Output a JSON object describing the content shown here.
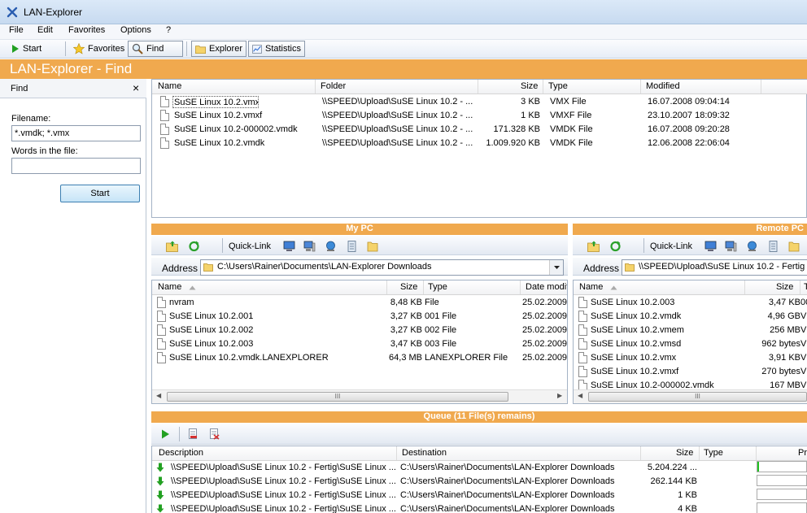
{
  "window": {
    "title": "LAN-Explorer"
  },
  "menu": {
    "file": "File",
    "edit": "Edit",
    "favorites": "Favorites",
    "options": "Options",
    "help": "?"
  },
  "toolbar": {
    "start": "Start",
    "favorites": "Favorites",
    "find": "Find",
    "explorer": "Explorer",
    "statistics": "Statistics"
  },
  "banner": {
    "title": "LAN-Explorer - Find"
  },
  "find_panel": {
    "header": "Find",
    "close": "×",
    "filename_label": "Filename:",
    "filename_value": "*.vmdk; *.vmx",
    "words_label": "Words in the file:",
    "words_value": "",
    "start_button": "Start"
  },
  "results": {
    "columns": {
      "name": "Name",
      "folder": "Folder",
      "size": "Size",
      "type": "Type",
      "modified": "Modified"
    },
    "rows": [
      {
        "name": "SuSE Linux 10.2.vmx",
        "folder": "\\\\SPEED\\Upload\\SuSE Linux 10.2 - ...",
        "size": "3 KB",
        "type": "VMX File",
        "modified": "16.07.2008 09:04:14"
      },
      {
        "name": "SuSE Linux 10.2.vmxf",
        "folder": "\\\\SPEED\\Upload\\SuSE Linux 10.2 - ...",
        "size": "1 KB",
        "type": "VMXF File",
        "modified": "23.10.2007 18:09:32"
      },
      {
        "name": "SuSE Linux 10.2-000002.vmdk",
        "folder": "\\\\SPEED\\Upload\\SuSE Linux 10.2 - ...",
        "size": "171.328 KB",
        "type": "VMDK File",
        "modified": "16.07.2008 09:20:28"
      },
      {
        "name": "SuSE Linux 10.2.vmdk",
        "folder": "\\\\SPEED\\Upload\\SuSE Linux 10.2 - ...",
        "size": "1.009.920 KB",
        "type": "VMDK File",
        "modified": "12.06.2008 22:06:04"
      }
    ]
  },
  "my_pc": {
    "title": "My PC",
    "quick_link": "Quick-Link",
    "address_label": "Address",
    "address_value": "C:\\Users\\Rainer\\Documents\\LAN-Explorer Downloads",
    "columns": {
      "name": "Name",
      "size": "Size",
      "type": "Type",
      "date": "Date modif"
    },
    "rows": [
      {
        "name": "nvram",
        "size": "8,48 KB",
        "type": "File",
        "date": "25.02.2009"
      },
      {
        "name": "SuSE Linux 10.2.001",
        "size": "3,27 KB",
        "type": "001 File",
        "date": "25.02.2009"
      },
      {
        "name": "SuSE Linux 10.2.002",
        "size": "3,27 KB",
        "type": "002 File",
        "date": "25.02.2009"
      },
      {
        "name": "SuSE Linux 10.2.003",
        "size": "3,47 KB",
        "type": "003 File",
        "date": "25.02.2009"
      },
      {
        "name": "SuSE Linux 10.2.vmdk.LANEXPLORER",
        "size": "64,3 MB",
        "type": "LANEXPLORER File",
        "date": "25.02.2009"
      }
    ],
    "scroll_grip": "III"
  },
  "remote_pc": {
    "title": "Remote PC",
    "quick_link": "Quick-Link",
    "address_label": "Address",
    "address_value": "\\\\SPEED\\Upload\\SuSE Linux 10.2 - Fertig",
    "columns": {
      "name": "Name",
      "size": "Size",
      "type": "T"
    },
    "rows": [
      {
        "name": "SuSE Linux 10.2.003",
        "size": "3,47 KB",
        "type": "00"
      },
      {
        "name": "SuSE Linux 10.2.vmdk",
        "size": "4,96 GB",
        "type": "V"
      },
      {
        "name": "SuSE Linux 10.2.vmem",
        "size": "256 MB",
        "type": "V"
      },
      {
        "name": "SuSE Linux 10.2.vmsd",
        "size": "962 bytes",
        "type": "V"
      },
      {
        "name": "SuSE Linux 10.2.vmx",
        "size": "3,91 KB",
        "type": "V"
      },
      {
        "name": "SuSE Linux 10.2.vmxf",
        "size": "270 bytes",
        "type": "V"
      },
      {
        "name": "SuSE Linux 10.2-000002.vmdk",
        "size": "167 MB",
        "type": "V"
      }
    ],
    "scroll_grip": "III"
  },
  "queue": {
    "title": "Queue (11 File(s) remains)",
    "columns": {
      "description": "Description",
      "destination": "Destination",
      "size": "Size",
      "type": "Type",
      "progress": "Pr"
    },
    "rows": [
      {
        "description": "\\\\SPEED\\Upload\\SuSE Linux 10.2 - Fertig\\SuSE Linux ...",
        "destination": "C:\\Users\\Rainer\\Documents\\LAN-Explorer Downloads",
        "size": "5.204.224 ...",
        "progress": 0.03
      },
      {
        "description": "\\\\SPEED\\Upload\\SuSE Linux 10.2 - Fertig\\SuSE Linux ...",
        "destination": "C:\\Users\\Rainer\\Documents\\LAN-Explorer Downloads",
        "size": "262.144 KB",
        "progress": 0
      },
      {
        "description": "\\\\SPEED\\Upload\\SuSE Linux 10.2 - Fertig\\SuSE Linux ...",
        "destination": "C:\\Users\\Rainer\\Documents\\LAN-Explorer Downloads",
        "size": "1 KB",
        "progress": 0
      },
      {
        "description": "\\\\SPEED\\Upload\\SuSE Linux 10.2 - Fertig\\SuSE Linux ...",
        "destination": "C:\\Users\\Rainer\\Documents\\LAN-Explorer Downloads",
        "size": "4 KB",
        "progress": 0
      }
    ]
  },
  "colors": {
    "accent_orange": "#f0a94e",
    "selection": "#316ac5",
    "progress_green": "#22c122"
  }
}
